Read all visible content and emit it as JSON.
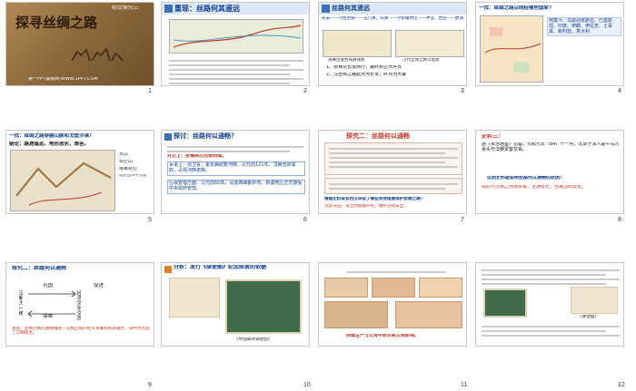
{
  "slides": [
    {
      "num": "1",
      "title": "探寻丝绸之路",
      "tag": "综合探究三",
      "footer": "第一PPT模板网-WWW.1PPT.COM"
    },
    {
      "num": "2",
      "title": "重现：丝路何其遥远"
    },
    {
      "num": "3",
      "title": "丝路何其遥远",
      "route1": "长安——河西走廊——玉门关，阳关——今新疆地区——中亚、西亚——欧洲",
      "caption_left": "张骞出使西域路线图",
      "caption_right": "汉代丝绸之路示意图",
      "note": "1、张骞从长安西行，最终到达大月氏",
      "note2": "2、汉丝绸之路起点为长安，终点为大秦"
    },
    {
      "num": "4",
      "title": "一找：丝绸之路沿线经哪些国家？",
      "label": "阿富汗、乌兹别克斯坦、巴基斯坦、印度、伊朗、伊拉克、土耳其、叙利亚、意大利"
    },
    {
      "num": "5",
      "title": "一找：丝绸之路穿越山脉和戈壁沙漠？",
      "conclusion": "结论：路途遥远，地形恶劣，艰苦。",
      "legend1": "天山",
      "legend2": "昆仑山",
      "legend3": "喀喇昆仑",
      "legend4": "塔克拉玛干沙漠"
    },
    {
      "num": "6",
      "title": "探讨：丝路何以通畅？",
      "box1": "外交上：张骞两次出使西域。",
      "box2": "军事上：派卫青、霍去病收复河西，公元前121年，汉朝击败匈奴，占领河西走廊。",
      "box3": "行政管理方面：公元前60年，设置西域都护府，新疆地区正式接受中央政府管辖。"
    },
    {
      "num": "7",
      "title": "探究二：丝路何以通畅",
      "q": "根据史料说说西汉采取了哪些有效措施保护丝绸之路？",
      "a": "驻兵屯田，设立西域都护府，维护沿线安全。"
    },
    {
      "num": "8",
      "title": "史料三：",
      "quote": "据《资治通鉴》记载，元和元年（84）十一月，北单于派人驱牛马万余头与汉朝贾客交易。",
      "q": "这则史料能说明丝路何以通畅的原因？",
      "a": "匈奴与汉朝之间通贸易，互通有无，丝路沿线安定。"
    },
    {
      "num": "9",
      "title": "探究二：丝路何以通畅",
      "items": [
        "巩固",
        "汉朝大一统",
        "促进",
        "保障",
        "经济文化交流"
      ],
      "footer": "关系：丝绸之路的通畅推动了沿线区域的经济发展和民族融合，同时也巩固了汉朝统治。"
    },
    {
      "num": "10",
      "title": "分析：发行《驿使图》纪念邮票的依据",
      "caption": "《中国邮政驿使图》"
    },
    {
      "num": "11",
      "title": "",
      "caption": "西域生产方式受中原农耕文明影响。"
    },
    {
      "num": "12",
      "title": "",
      "caption": "《驿使图》"
    }
  ]
}
